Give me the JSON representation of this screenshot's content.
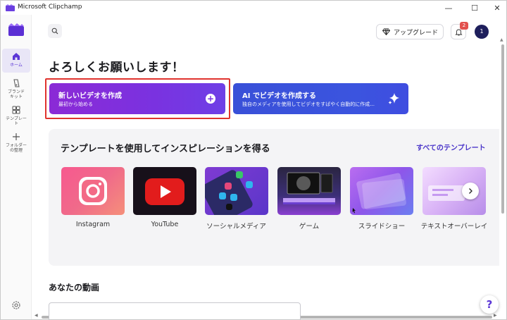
{
  "window": {
    "title": "Microsoft Clipchamp",
    "minimize_glyph": "—",
    "maximize_glyph": "☐",
    "close_glyph": "✕"
  },
  "rail": {
    "items": [
      {
        "label": "ホーム",
        "icon": "home-icon",
        "active": true
      },
      {
        "label": "ブランド\nキット",
        "icon": "brand-kit-icon",
        "active": false
      },
      {
        "label": "テンプレー\nト",
        "icon": "templates-icon",
        "active": false
      },
      {
        "label": "フォルダー\nの整理",
        "icon": "plus-icon",
        "active": false
      }
    ],
    "settings_icon": "gear-icon"
  },
  "topbar": {
    "upgrade_label": "アップグレード",
    "notification_count": "2",
    "avatar_initial": "1"
  },
  "greeting": "よろしくお願いします！",
  "cards": {
    "new_video": {
      "title": "新しいビデオを作成",
      "subtitle": "最初から始める"
    },
    "ai_video": {
      "title": "AI でビデオを作成する",
      "subtitle": "独自のメディアを使用してビデオをすばやく自動的に作成..."
    }
  },
  "templates": {
    "heading": "テンプレートを使用してインスピレーションを得る",
    "all_link": "すべてのテンプレート",
    "tiles": [
      {
        "label": "Instagram"
      },
      {
        "label": "YouTube"
      },
      {
        "label": "ソーシャルメディア"
      },
      {
        "label": "ゲーム"
      },
      {
        "label": "スライドショー"
      },
      {
        "label": "テキストオーバーレイ"
      }
    ]
  },
  "videos": {
    "heading": "あなたの動画"
  },
  "help_label": "?",
  "colors": {
    "accent": "#5b36d6",
    "new_card": "#7a32e0",
    "ai_card": "#3b54df",
    "highlight_border": "#e0332e",
    "badge": "#e2504d"
  }
}
